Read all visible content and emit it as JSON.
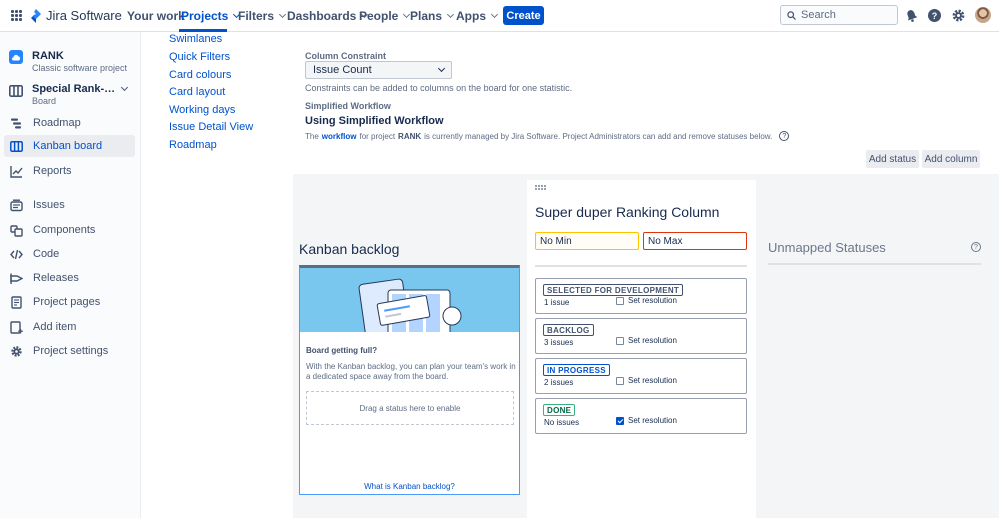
{
  "topnav": {
    "product": "Jira Software",
    "items": [
      {
        "label": "Your work",
        "dropdown": false
      },
      {
        "label": "Projects",
        "dropdown": true
      },
      {
        "label": "Filters",
        "dropdown": true
      },
      {
        "label": "Dashboards",
        "dropdown": true
      },
      {
        "label": "People",
        "dropdown": true
      },
      {
        "label": "Plans",
        "dropdown": true
      },
      {
        "label": "Apps",
        "dropdown": true
      }
    ],
    "create_label": "Create",
    "search_placeholder": "Search",
    "icons": [
      "notifications-icon",
      "help-icon",
      "settings-icon"
    ]
  },
  "sidebar": {
    "project_name": "RANK",
    "project_type": "Classic software project",
    "board_name": "Special Rank-o-matic",
    "board_label": "Board",
    "items": [
      {
        "label": "Roadmap",
        "icon": "roadmap-icon",
        "active": false
      },
      {
        "label": "Kanban board",
        "icon": "board-icon",
        "active": true
      },
      {
        "label": "Reports",
        "icon": "reports-icon",
        "active": false
      },
      {
        "label": "Issues",
        "icon": "issues-icon",
        "active": false
      },
      {
        "label": "Components",
        "icon": "components-icon",
        "active": false
      },
      {
        "label": "Code",
        "icon": "code-icon",
        "active": false
      },
      {
        "label": "Releases",
        "icon": "releases-icon",
        "active": false
      },
      {
        "label": "Project pages",
        "icon": "pages-icon",
        "active": false
      },
      {
        "label": "Add item",
        "icon": "add-item-icon",
        "active": false
      },
      {
        "label": "Project settings",
        "icon": "settings-icon",
        "active": false
      }
    ]
  },
  "settings_nav": [
    "Swimlanes",
    "Quick Filters",
    "Card colours",
    "Card layout",
    "Working days",
    "Issue Detail View",
    "Roadmap"
  ],
  "constraint": {
    "label": "Column Constraint",
    "value": "Issue Count",
    "note": "Constraints can be added to columns on the board for one statistic."
  },
  "workflow": {
    "label": "Simplified Workflow",
    "title": "Using Simplified Workflow",
    "desc_prefix": "The",
    "desc_link": "workflow",
    "desc_mid": "for project",
    "desc_project": "RANK",
    "desc_suffix": "is currently managed by Jira Software. Project Administrators can add and remove statuses below.",
    "help_glyph": "?"
  },
  "actions": {
    "add_status": "Add status",
    "add_column": "Add column"
  },
  "backlog": {
    "title": "Kanban backlog",
    "heading": "Board getting full?",
    "text": "With the Kanban backlog, you can plan your team's work in a dedicated space away from the board.",
    "drop_hint": "Drag a status here to enable",
    "link": "What is Kanban backlog?"
  },
  "column": {
    "name": "Super duper Ranking Column",
    "min_placeholder": "No Min",
    "max_placeholder": "No Max",
    "statuses": [
      {
        "label": "SELECTED FOR DEVELOPMENT",
        "style": "gray",
        "count": "1 issue",
        "resolution_label": "Set resolution",
        "resolution_checked": false
      },
      {
        "label": "BACKLOG",
        "style": "gray",
        "count": "3 issues",
        "resolution_label": "Set resolution",
        "resolution_checked": false
      },
      {
        "label": "IN PROGRESS",
        "style": "blue",
        "count": "2 issues",
        "resolution_label": "Set resolution",
        "resolution_checked": false
      },
      {
        "label": "DONE",
        "style": "green",
        "count": "No issues",
        "resolution_label": "Set resolution",
        "resolution_checked": true
      }
    ]
  },
  "unmapped": {
    "title": "Unmapped Statuses",
    "help_glyph": "?"
  },
  "colors": {
    "brand": "#0052cc",
    "min_border": "#ffc400",
    "max_border": "#de350b",
    "done_green": "#36b37e"
  }
}
